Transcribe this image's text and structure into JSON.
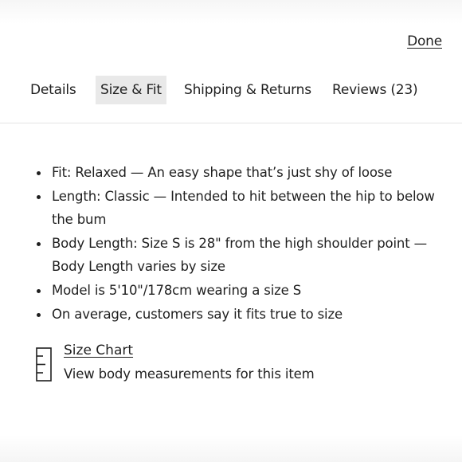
{
  "header": {
    "done_label": "Done"
  },
  "tabs": [
    {
      "label": "Details",
      "active": false
    },
    {
      "label": "Size & Fit",
      "active": true
    },
    {
      "label": "Shipping & Returns",
      "active": false
    },
    {
      "label": "Reviews (23)",
      "active": false
    }
  ],
  "fit_details": [
    "Fit: Relaxed — An easy shape that’s just shy of loose",
    "Length: Classic — Intended to hit between the hip to below the bum",
    "Body Length: Size S is 28\" from the high shoulder point — Body Length varies by size",
    "Model is 5'10\"/178cm wearing a size S",
    "On average, customers say it fits true to size"
  ],
  "size_chart": {
    "icon": "ruler-icon",
    "link_label": "Size Chart",
    "description": "View body measurements for this item"
  },
  "colors": {
    "text": "#1f1f1f",
    "active_tab_bg": "#e9e9e9",
    "divider": "#e4e4e4"
  }
}
